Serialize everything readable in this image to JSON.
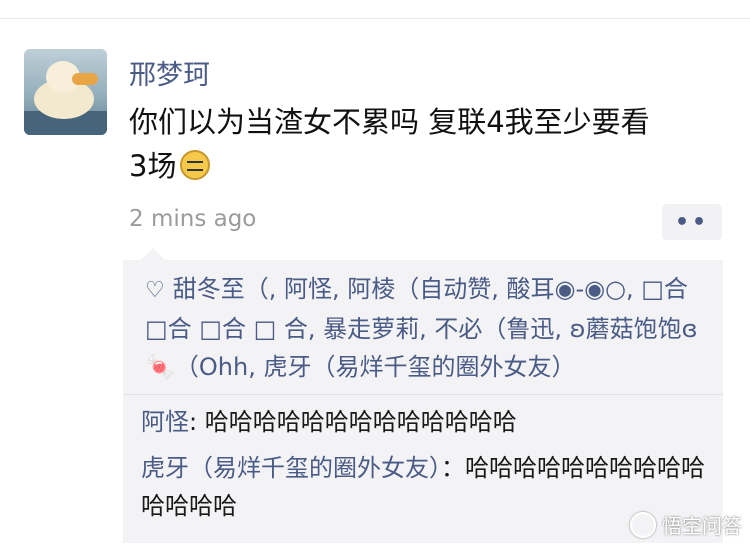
{
  "post": {
    "username": "邢梦珂",
    "message_line1": "你们以为当渣女不累吗 复联4我至少要看",
    "message_line2": "3场",
    "timestamp": "2 mins ago",
    "more_label": "••"
  },
  "likes": {
    "text": "甜冬至（, 阿怪, 阿棱（自动赞, 酸耳◉-◉○, □合 □合 □合 □ 合, 暴走萝莉, 不必（鲁迅, ʚ蘑菇饱饱ɞ🍬（Ohh, 虎牙（易烊千玺的圈外女友）"
  },
  "comments": [
    {
      "author": "阿怪",
      "text": ": 哈哈哈哈哈哈哈哈哈哈哈哈哈"
    },
    {
      "author": "虎牙（易烊千玺的圈外女友）",
      "text": "：哈哈哈哈哈哈哈哈哈哈哈哈哈哈"
    }
  ],
  "watermark": {
    "text": "悟空问答"
  },
  "colors": {
    "accent": "#4a5b86",
    "comment_bg": "#f3f3f5",
    "timestamp": "#9b9b9b"
  },
  "icons": {
    "heart": "heart-outline-icon",
    "emoji": "cool-sunglasses-emoji-icon",
    "more": "more-dots-icon"
  }
}
